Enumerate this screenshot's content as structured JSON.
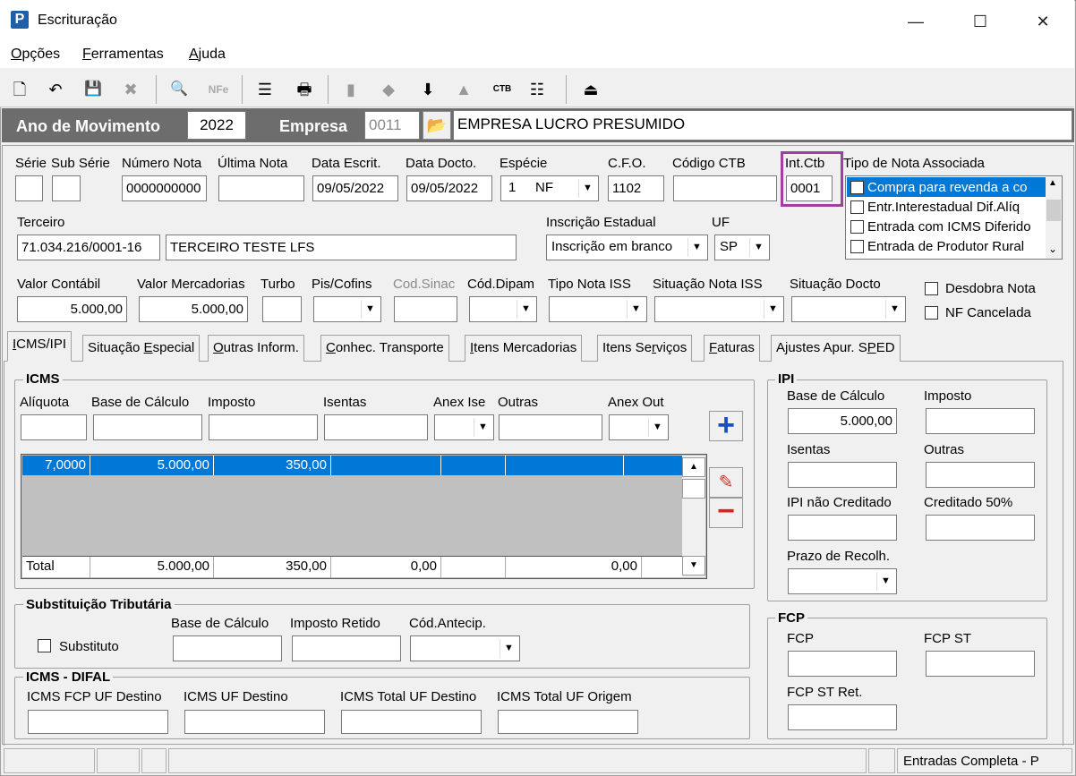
{
  "window": {
    "title": "Escrituração",
    "icon_letter": "P",
    "minimize": "—",
    "maximize": "☐",
    "close": "✕"
  },
  "menu": [
    {
      "label": "Opções",
      "underline": "O",
      "rest": "pções"
    },
    {
      "label": "Ferramentas",
      "underline": "F",
      "rest": "erramentas"
    },
    {
      "label": "Ajuda",
      "underline": "A",
      "rest": "juda"
    }
  ],
  "toolbar": {
    "new": "🗋",
    "undo": "↶",
    "save": "💾",
    "delete": "✖",
    "preview": "🔍",
    "nfe": "NFe",
    "tree": "☰",
    "print": "🖶",
    "b1": "▮",
    "b2": "◆",
    "b3": "⬇",
    "b4": "▲",
    "ctb": "CTB",
    "b6": "☷",
    "exit": "⏏"
  },
  "header": {
    "ano_label": "Ano de Movimento",
    "ano_value": "2022",
    "empresa_label": "Empresa",
    "empresa_code": "0011",
    "empresa_name": "EMPRESA LUCRO PRESUMIDO"
  },
  "row1": {
    "serie_label": "Série",
    "subserie_label": "Sub Série",
    "numero_label": "Número Nota",
    "ultima_label": "Última Nota",
    "data_escrit_label": "Data Escrit.",
    "data_docto_label": "Data Docto.",
    "especie_label": "Espécie",
    "cfo_label": "C.F.O.",
    "ctb_label": "Código CTB",
    "intctb_label": "Int.Ctb",
    "tipo_assoc_label": "Tipo de Nota Associada",
    "serie": "",
    "subserie": "",
    "numero": "0000000000",
    "ultima": "",
    "data_escrit": "09/05/2022",
    "data_docto": "09/05/2022",
    "especie_code": "1",
    "especie": "NF",
    "cfo": "1102",
    "ctb": "",
    "intctb": "0001"
  },
  "tipo_assoc": [
    "Compra para revenda a co",
    "Entr.Interestadual Dif.Alíq",
    "Entrada com ICMS Diferido",
    "Entrada de Produtor Rural"
  ],
  "row2": {
    "terceiro_label": "Terceiro",
    "terceiro_cnpj": "71.034.216/0001-16",
    "terceiro_nome": "TERCEIRO TESTE LFS",
    "ie_label": "Inscrição Estadual",
    "ie_value": "Inscrição em branco",
    "uf_label": "UF",
    "uf_value": "SP"
  },
  "row3": {
    "valor_contabil_label": "Valor Contábil",
    "valor_contabil": "5.000,00",
    "valor_merc_label": "Valor Mercadorias",
    "valor_merc": "5.000,00",
    "turbo_label": "Turbo",
    "piscofins_label": "Pis/Cofins",
    "codsinac_label": "Cod.Sinac",
    "coddipam_label": "Cód.Dipam",
    "tipoiss_label": "Tipo Nota ISS",
    "situacaoiss_label": "Situação Nota ISS",
    "situacaodocto_label": "Situação Docto",
    "desdobra_label": "Desdobra Nota",
    "cancelada_label": "NF Cancelada"
  },
  "tabs": [
    {
      "pre": "",
      "u": "I",
      "post": "CMS/IPI"
    },
    {
      "pre": "Situação ",
      "u": "E",
      "post": "special"
    },
    {
      "pre": "",
      "u": "O",
      "post": "utras Inform."
    },
    {
      "pre": "",
      "u": "C",
      "post": "onhec. Transporte"
    },
    {
      "pre": "",
      "u": "I",
      "post": "tens Mercadorias"
    },
    {
      "pre": "Itens Se",
      "u": "r",
      "post": "viços"
    },
    {
      "pre": "",
      "u": "F",
      "post": "aturas"
    },
    {
      "pre": "Ajustes Apur. S",
      "u": "P",
      "post": "ED"
    }
  ],
  "icms": {
    "title": "ICMS",
    "aliquota_label": "Alíquota",
    "base_label": "Base de Cálculo",
    "imposto_label": "Imposto",
    "isentas_label": "Isentas",
    "anexise_label": "Anex Ise",
    "outras_label": "Outras",
    "anexout_label": "Anex Out",
    "row": {
      "aliquota": "7,0000",
      "base": "5.000,00",
      "imposto": "350,00"
    },
    "total": {
      "label": "Total",
      "base": "5.000,00",
      "imposto": "350,00",
      "isentas": "0,00",
      "outras": "0,00"
    }
  },
  "st": {
    "title": "Substituição Tributária",
    "substituto_label": "Substituto",
    "base_label": "Base de Cálculo",
    "retido_label": "Imposto Retido",
    "antecip_label": "Cód.Antecip."
  },
  "difal": {
    "title": "ICMS - DIFAL",
    "fcp_label": "ICMS FCP UF Destino",
    "uf_dest_label": "ICMS UF Destino",
    "total_dest_label": "ICMS Total UF Destino",
    "total_orig_label": "ICMS Total UF Origem"
  },
  "ipi": {
    "title": "IPI",
    "base_label": "Base de Cálculo",
    "base": "5.000,00",
    "imposto_label": "Imposto",
    "isentas_label": "Isentas",
    "outras_label": "Outras",
    "naocred_label": "IPI não Creditado",
    "cred50_label": "Creditado 50%",
    "prazo_label": "Prazo de Recolh."
  },
  "fcp": {
    "title": "FCP",
    "fcp_label": "FCP",
    "fcpst_label": "FCP ST",
    "fcpstret_label": "FCP ST Ret."
  },
  "status": {
    "text": "Entradas Completa - P"
  },
  "colors": {
    "dark_bar": "#6d6d6d",
    "selection": "#0078d7",
    "highlight_box": "#a040a0"
  }
}
